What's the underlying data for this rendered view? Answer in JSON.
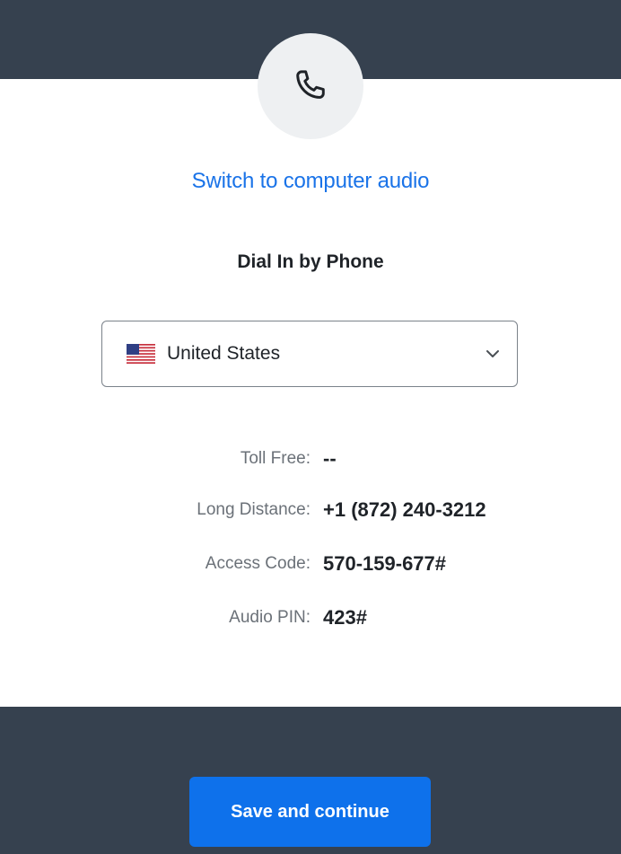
{
  "header": {
    "icon": "phone-icon"
  },
  "audio": {
    "switch_link": "Switch to computer audio"
  },
  "dial_in": {
    "title": "Dial In by Phone",
    "country": {
      "selected": "United States",
      "flag_icon": "us-flag-icon",
      "dropdown_icon": "chevron-down-icon"
    },
    "rows": [
      {
        "label": "Toll Free:",
        "value": "--"
      },
      {
        "label": "Long Distance:",
        "value": "+1 (872) 240-3212"
      },
      {
        "label": "Access Code:",
        "value": "570-159-677#"
      },
      {
        "label": "Audio PIN:",
        "value": "423#"
      }
    ]
  },
  "footer": {
    "save_label": "Save and continue"
  },
  "colors": {
    "header_bg": "#36414f",
    "link": "#1a73e8",
    "primary_button": "#0e71eb"
  }
}
